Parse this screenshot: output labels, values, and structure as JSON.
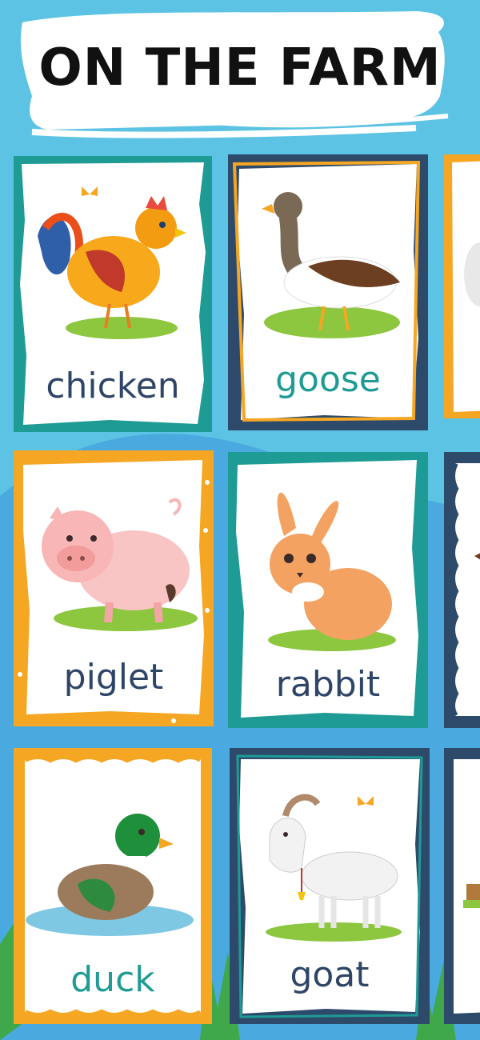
{
  "title": "ON THE FARM",
  "colors": {
    "sky": "#5cc3e4",
    "teal": "#1e9b95",
    "navy": "#2e4a6b",
    "orange": "#f5a623",
    "label_navy": "#2f4568",
    "label_teal": "#1f9b94"
  },
  "cards": [
    {
      "label": "chicken",
      "animal": "chicken-illustration"
    },
    {
      "label": "goose",
      "animal": "goose-illustration"
    },
    {
      "label": "piglet",
      "animal": "pig-illustration"
    },
    {
      "label": "rabbit",
      "animal": "rabbit-illustration"
    },
    {
      "label": "duck",
      "animal": "duck-illustration"
    },
    {
      "label": "goat",
      "animal": "goat-illustration"
    }
  ]
}
